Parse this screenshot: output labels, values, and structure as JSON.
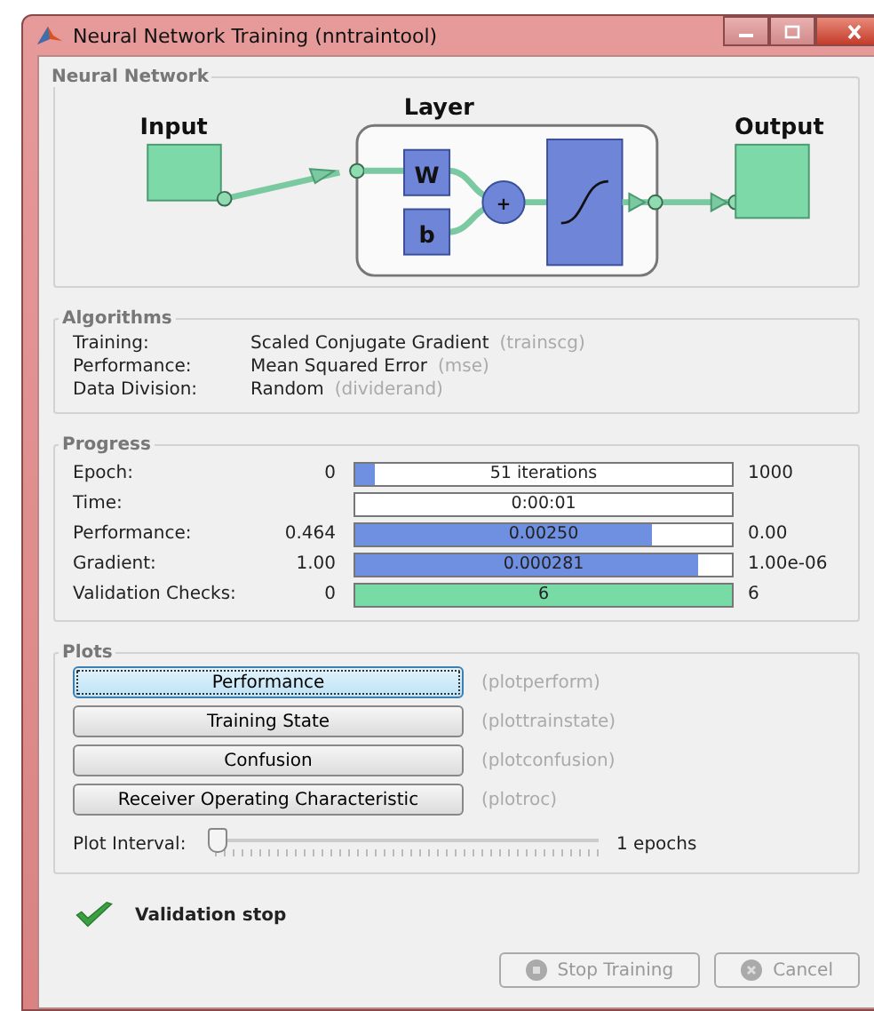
{
  "window": {
    "title": "Neural Network Training (nntraintool)"
  },
  "network": {
    "title": "Neural Network",
    "input_label": "Input",
    "layer_label": "Layer",
    "output_label": "Output",
    "weight_label": "W",
    "bias_label": "b",
    "sum_label": "+"
  },
  "algorithms": {
    "title": "Algorithms",
    "rows": [
      {
        "label": "Training:",
        "value": "Scaled Conjugate Gradient",
        "code": "(trainscg)"
      },
      {
        "label": "Performance:",
        "value": "Mean Squared Error",
        "code": "(mse)"
      },
      {
        "label": "Data Division:",
        "value": "Random",
        "code": "(dividerand)"
      }
    ]
  },
  "progress": {
    "title": "Progress",
    "rows": [
      {
        "kind": "meter",
        "label": "Epoch:",
        "start": "0",
        "reading": "51 iterations",
        "level": 0.05,
        "color": "#6f8fe0",
        "end": "1000"
      },
      {
        "kind": "readout",
        "label": "Time:",
        "start": "",
        "reading": "0:00:01",
        "end": ""
      },
      {
        "kind": "meter",
        "label": "Performance:",
        "start": "0.464",
        "reading": "0.00250",
        "level": 0.79,
        "color": "#6f8fe0",
        "end": "0.00"
      },
      {
        "kind": "meter",
        "label": "Gradient:",
        "start": "1.00",
        "reading": "0.000281",
        "level": 0.91,
        "color": "#6f8fe0",
        "end": "1.00e-06"
      },
      {
        "kind": "meter",
        "label": "Validation Checks:",
        "start": "0",
        "reading": "6",
        "level": 1,
        "color": "#78dba6",
        "end": "6"
      }
    ]
  },
  "plots": {
    "title": "Plots",
    "buttons": [
      {
        "label": "Performance",
        "code": "(plotperform)",
        "selected": true
      },
      {
        "label": "Training State",
        "code": "(plottrainstate)",
        "selected": false
      },
      {
        "label": "Confusion",
        "code": "(plotconfusion)",
        "selected": false
      },
      {
        "label": "Receiver Operating Characteristic",
        "code": "(plotroc)",
        "selected": false
      }
    ],
    "interval": {
      "label": "Plot Interval:",
      "level": 0,
      "reading": "1 epochs"
    }
  },
  "status": {
    "text": "Validation stop"
  },
  "actions": [
    {
      "label": "Stop Training",
      "disabled": true,
      "kind": "stop"
    },
    {
      "label": "Cancel",
      "disabled": true,
      "kind": "cancel"
    }
  ]
}
